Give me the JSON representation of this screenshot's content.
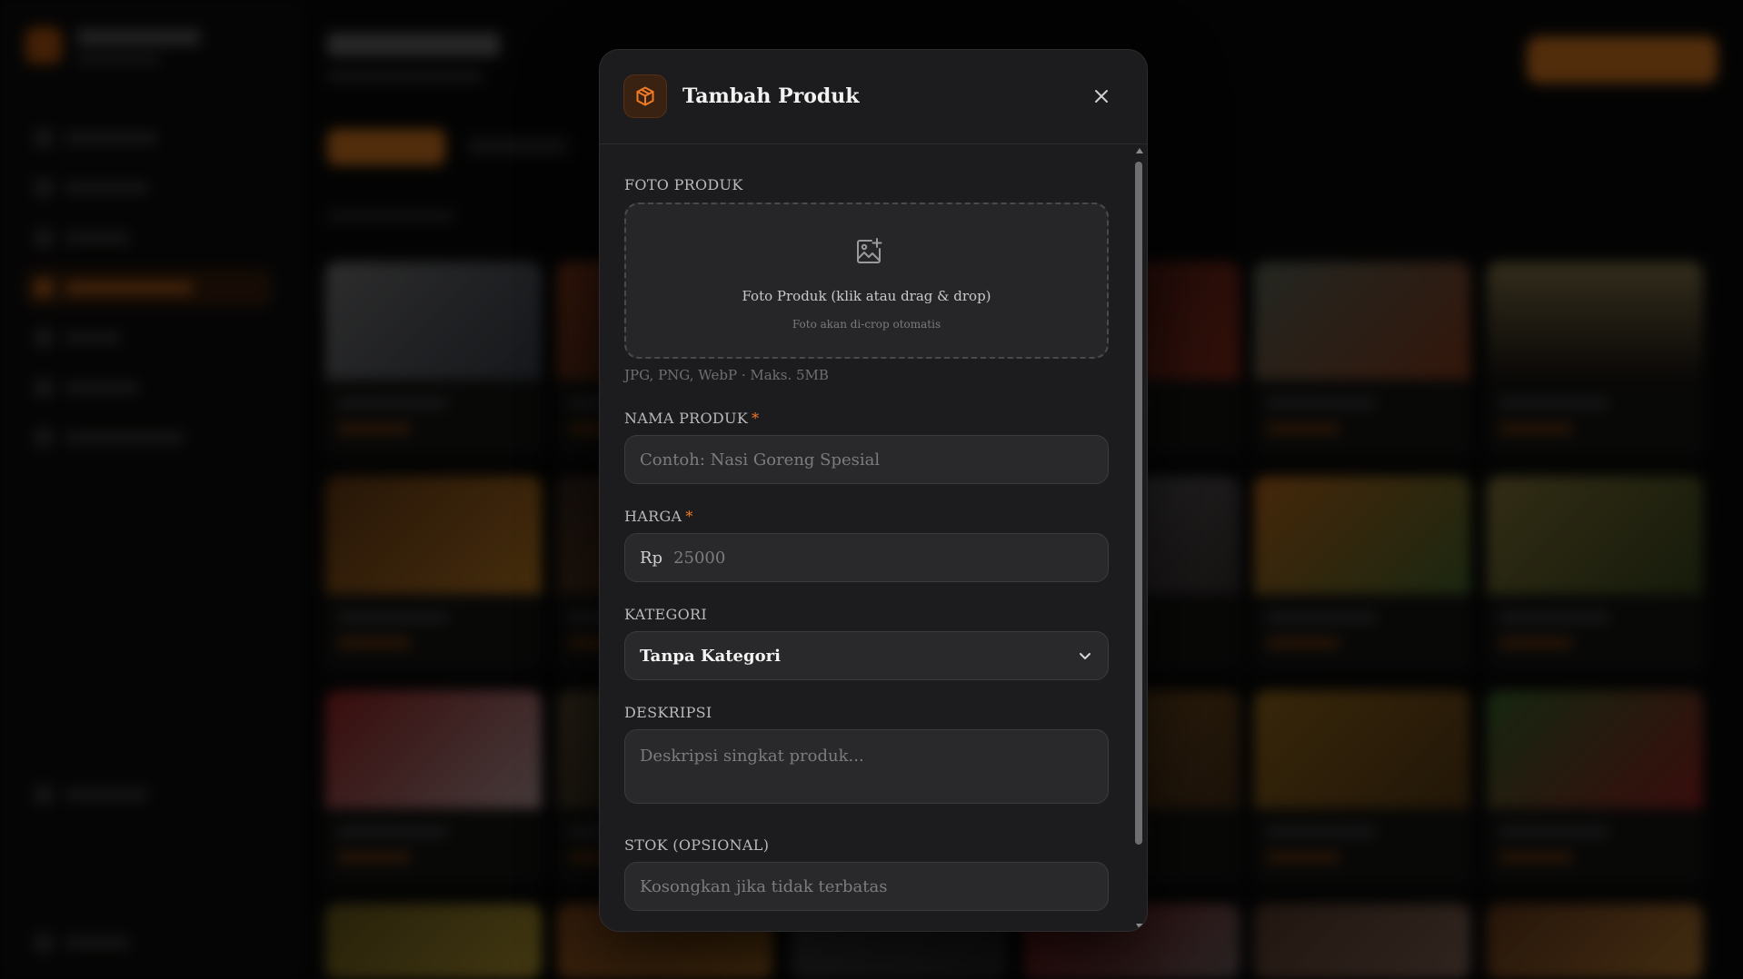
{
  "modal": {
    "title": "Tambah Produk",
    "header_icon": "package-icon",
    "close_icon": "close-icon"
  },
  "form": {
    "photo": {
      "label": "FOTO PRODUK",
      "icon": "image-add-icon",
      "dropzone_text": "Foto Produk (klik atau drag & drop)",
      "dropzone_subtext": "Foto akan di-crop otomatis",
      "hint": "JPG, PNG, WebP · Maks. 5MB"
    },
    "name": {
      "label": "NAMA PRODUK",
      "required_mark": "*",
      "placeholder": "Contoh: Nasi Goreng Spesial"
    },
    "price": {
      "label": "HARGA",
      "required_mark": "*",
      "prefix": "Rp",
      "placeholder": "25000"
    },
    "category": {
      "label": "KATEGORI",
      "selected": "Tanpa Kategori",
      "icon": "chevron-down-icon"
    },
    "description": {
      "label": "DESKRIPSI",
      "placeholder": "Deskripsi singkat produk..."
    },
    "stock": {
      "label": "STOK (OPSIONAL)",
      "placeholder": "Kosongkan jika tidak terbatas"
    }
  },
  "colors": {
    "accent": "#f07a26",
    "modal_bg": "#1c1c1e",
    "input_bg": "#29292b"
  }
}
